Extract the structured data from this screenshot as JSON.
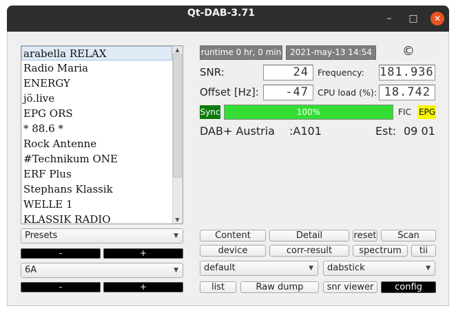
{
  "window": {
    "title": "Qt-DAB-3.71",
    "minimize_glyph": "–",
    "maximize_glyph": "□",
    "close_glyph": "✕"
  },
  "stations": {
    "selected_index": 0,
    "items": [
      "arabella RELAX",
      "Radio Maria",
      "ENERGY",
      "jö.live",
      "EPG ORS",
      "* 88.6 *",
      "Rock Antenne",
      "#Technikum ONE",
      "ERF Plus",
      "Stephans Klassik",
      "WELLE 1",
      "KLASSIK RADIO"
    ]
  },
  "left_controls": {
    "presets_value": "Presets",
    "minus_label": "-",
    "plus_label": "+",
    "channel_value": "6A"
  },
  "status": {
    "runtime": "runtime 0 hr, 0 min",
    "date": "2021-may-13  14:54",
    "copyright": "©",
    "snr_label": "SNR:",
    "snr_value": "24",
    "frequency_label": "Frequency:",
    "frequency_value": "181.936",
    "offset_label": "Offset [Hz]:",
    "offset_value": "-47",
    "cpu_label": "CPU load (%):",
    "cpu_value": "18.742",
    "sync_label": "Sync",
    "quality_percent": 100,
    "quality_text": "100%",
    "fic_label": "FIC",
    "epg_label": "EPG",
    "ensemble_name": "DAB+ Austria",
    "ensemble_id": ":A101",
    "est_label": "Est:",
    "est_value": "09 01"
  },
  "buttons": {
    "content": "Content",
    "detail": "Detail",
    "reset": "reset",
    "scan": "Scan",
    "device": "device",
    "corr_result": "corr-result",
    "spectrum": "spectrum",
    "tii": "tii",
    "list": "list",
    "raw_dump": "Raw dump",
    "snr_viewer": "snr viewer",
    "config": "config"
  },
  "selects": {
    "mode_value": "default",
    "device_value": "dabstick"
  },
  "colors": {
    "sync_green": "#0d7a0d",
    "progress_green": "#33dd33",
    "epg_yellow": "#f6f600",
    "titlebar": "#2e2e2e",
    "close_orange": "#e95420"
  }
}
